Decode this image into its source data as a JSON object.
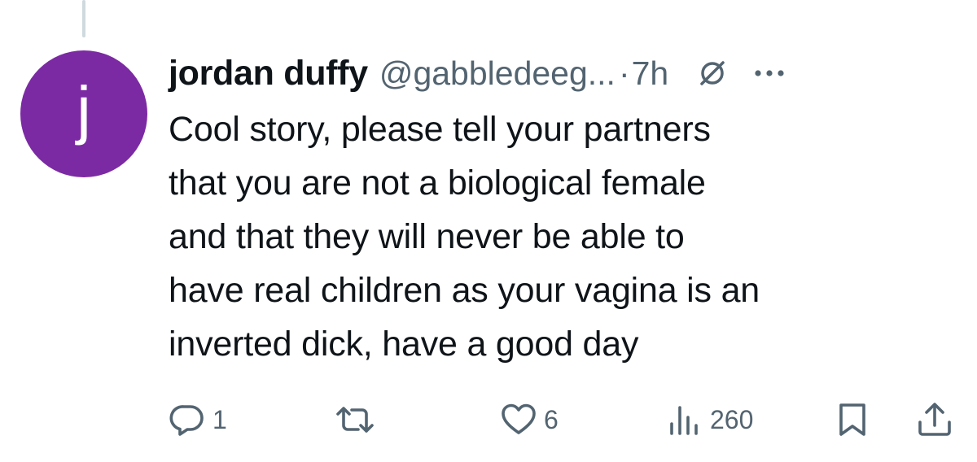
{
  "tweet": {
    "author": {
      "display_name": "jordan duffy",
      "handle": "@gabbledeeg...",
      "avatar_letter": "j",
      "avatar_color": "#7b2aa3"
    },
    "separator": "·",
    "time": "7h",
    "text": "Cool story, please tell your partners\nthat you are not a biological female\nand that they will never be able to\nhave real children as your vagina is an\ninverted dick, have a good day",
    "header_icons": [
      "grok-icon",
      "more-icon"
    ]
  },
  "actions": {
    "reply": {
      "icon": "reply-icon",
      "count": "1"
    },
    "retweet": {
      "icon": "retweet-icon",
      "count": ""
    },
    "like": {
      "icon": "heart-icon",
      "count": "6"
    },
    "views": {
      "icon": "views-icon",
      "count": "260"
    },
    "bookmark": {
      "icon": "bookmark-icon"
    },
    "share": {
      "icon": "share-icon"
    }
  },
  "colors": {
    "text_primary": "#0f1419",
    "text_secondary": "#536471",
    "thread_line": "#cfd9de"
  }
}
